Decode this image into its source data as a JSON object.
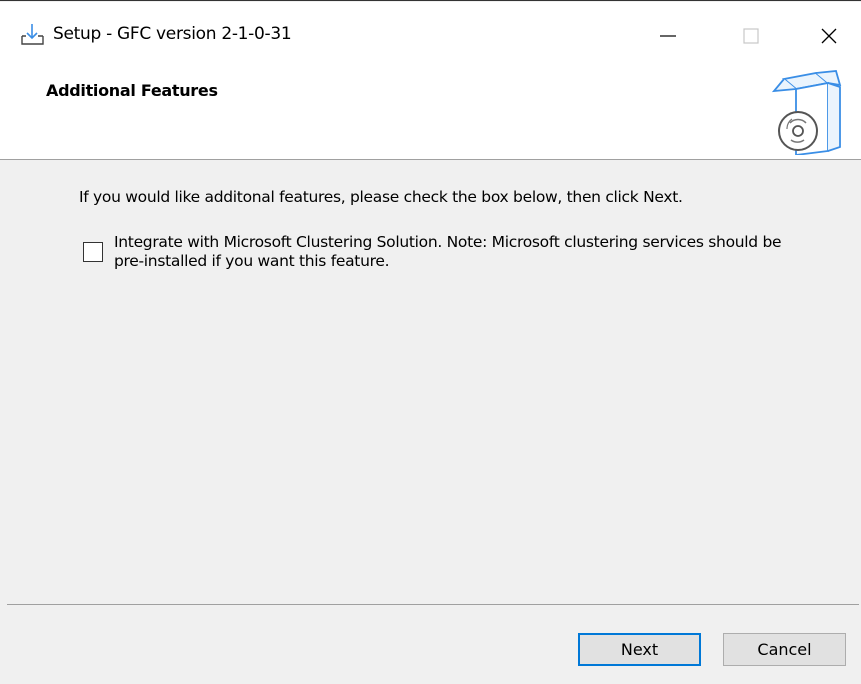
{
  "window": {
    "title": "Setup - GFC version 2-1-0-31",
    "icon": "download-tray-icon",
    "controls": [
      "minimize-icon",
      "maximize-icon",
      "close-icon"
    ]
  },
  "header": {
    "title": "Additional Features",
    "graphic": "software-box-cd-icon"
  },
  "content": {
    "instruction": "If you would like additonal features, please check the box below, then click Next.",
    "option": {
      "checked": false,
      "label": "Integrate with Microsoft Clustering Solution. Note: Microsoft clustering services should be pre-installed if you want this feature."
    }
  },
  "footer": {
    "next_label": "Next",
    "cancel_label": "Cancel"
  },
  "colors": {
    "accent": "#0078d7",
    "dialog_background": "#f0f0f0",
    "header_background": "#ffffff"
  }
}
